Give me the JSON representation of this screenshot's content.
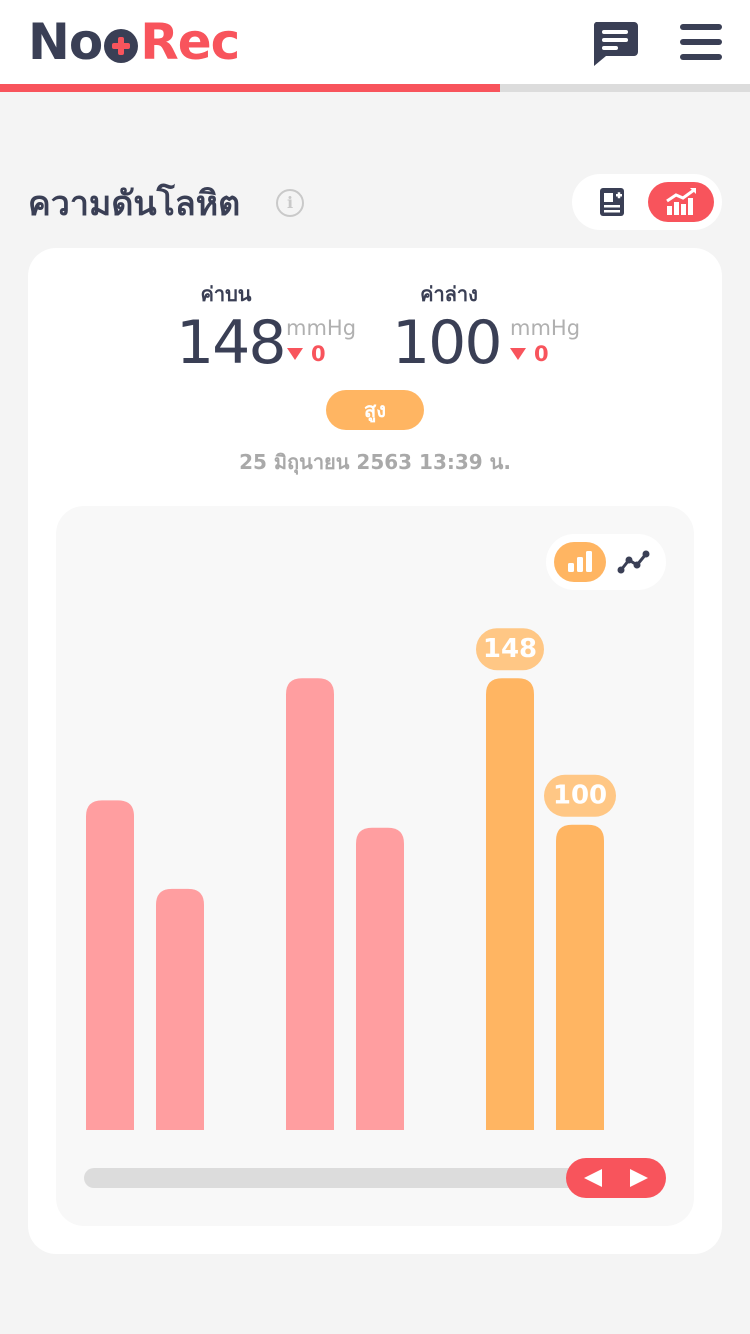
{
  "header": {
    "logo_part1": "No",
    "logo_part2": "Rec",
    "progress_fraction": 0.667
  },
  "section": {
    "title": "ความดันโลหิต"
  },
  "summary": {
    "upper_label": "ค่าบน",
    "upper_value": "148",
    "upper_unit": "mmHg",
    "upper_delta": "0",
    "lower_label": "ค่าล่าง",
    "lower_value": "100",
    "lower_unit": "mmHg",
    "lower_delta": "0",
    "status": "สูง",
    "datetime": "25 มิถุนายน 2563 13:39 น."
  },
  "colors": {
    "brand_dark": "#3a3f55",
    "brand_red": "#f8545c",
    "accent_orange": "#ffb562",
    "bar_past": "#ff9ea0"
  },
  "icons": {
    "chat": "chat-icon",
    "menu": "hamburger-menu-icon",
    "info": "info-icon",
    "list_view": "add-record-icon",
    "chart_view": "chart-trend-icon",
    "bar_chart": "bar-chart-icon",
    "line_chart": "line-chart-icon",
    "prev": "arrow-left-icon",
    "next": "arrow-right-icon"
  },
  "chart_data": {
    "type": "bar",
    "ylim": [
      0,
      190
    ],
    "grid": false,
    "legend": "none",
    "series": [
      {
        "values": [
          108,
          148,
          148
        ]
      },
      {
        "values": [
          79,
          99,
          100
        ]
      }
    ],
    "highlighted_index": 2,
    "data_labels": [
      "148",
      "100"
    ]
  }
}
